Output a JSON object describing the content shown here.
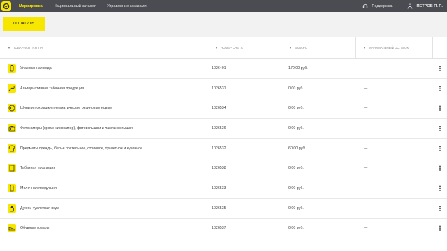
{
  "nav": {
    "items": [
      {
        "label": "Маркировка",
        "active": true
      },
      {
        "label": "Национальный каталог",
        "active": false
      },
      {
        "label": "Управление заказами",
        "active": false
      }
    ],
    "support_label": "Поддержка",
    "user_name": "ПЕТРОВ П. П."
  },
  "actions": {
    "pay_label": "ОПЛАТИТЬ"
  },
  "table": {
    "headers": {
      "group": "ТОВАРНАЯ ГРУППА",
      "account": "НОМЕР СЧЕТА",
      "balance": "БАЛАНС",
      "min": "МИНИМАЛЬНЫЙ ОСТАТОК"
    },
    "rows": [
      {
        "icon": "bottle-icon",
        "group": "Упакованная вода",
        "account": "1026401",
        "balance": "170,00 руб.",
        "min": "—"
      },
      {
        "icon": "pipe-icon",
        "group": "Альтернативная табачная продукция",
        "account": "1026531",
        "balance": "0,00 руб.",
        "min": "—"
      },
      {
        "icon": "tire-icon",
        "group": "Шины и покрышки пневматические резиновые новые",
        "account": "1026534",
        "balance": "0,00 руб.",
        "min": "—"
      },
      {
        "icon": "camera-icon",
        "group": "Фотокамеры (кроме кинокамер), фотовспышки и лампы-вспышки",
        "account": "1026536",
        "balance": "0,00 руб.",
        "min": "—"
      },
      {
        "icon": "clothes-icon",
        "group": "Предметы одежды, белье постельное, столовое, туалетное и кухонное",
        "account": "1026532",
        "balance": "60,00 руб.",
        "min": "—"
      },
      {
        "icon": "tobacco-icon",
        "group": "Табачная продукция",
        "account": "1026538",
        "balance": "0,00 руб.",
        "min": "—"
      },
      {
        "icon": "milk-icon",
        "group": "Молочная продукция",
        "account": "1026533",
        "balance": "0,00 руб.",
        "min": "—"
      },
      {
        "icon": "perfume-icon",
        "group": "Духи и туалетная вода",
        "account": "1026535",
        "balance": "0,00 руб.",
        "min": "—"
      },
      {
        "icon": "shoe-icon",
        "group": "Обувные товары",
        "account": "1026537",
        "balance": "0,00 руб.",
        "min": "—"
      }
    ]
  },
  "colors": {
    "accent": "#f7e600",
    "topbar": "#4a4c52"
  }
}
